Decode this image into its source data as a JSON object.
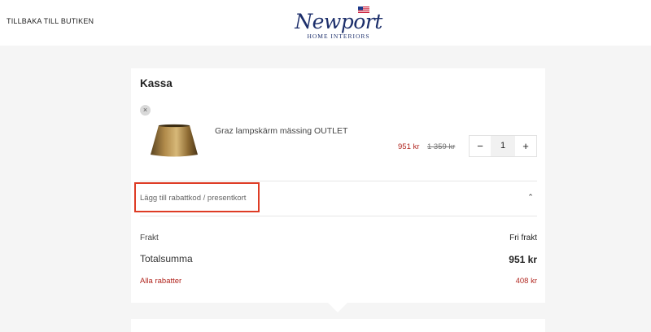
{
  "header": {
    "back_link": "TILLBAKA TILL BUTIKEN",
    "logo_script": "Newport",
    "logo_sub": "HOME INTERIORS"
  },
  "checkout": {
    "title": "Kassa",
    "item": {
      "remove": "×",
      "name": "Graz lampskärm mässing OUTLET",
      "price": "951 kr",
      "original_price": "1 359 kr",
      "quantity": "1",
      "decrement": "−",
      "increment": "+"
    },
    "discount": {
      "label": "Lägg till rabattkod / presentkort",
      "toggle": "⌃"
    },
    "summary": {
      "shipping_label": "Frakt",
      "shipping_value": "Fri frakt",
      "total_label": "Totalsumma",
      "total_value": "951 kr",
      "discounts_label": "Alla rabatter",
      "discounts_value": "408 kr"
    }
  },
  "colors": {
    "accent_red": "#b1261f",
    "highlight_border": "#de3c25",
    "brand_navy": "#1d2f6b"
  }
}
